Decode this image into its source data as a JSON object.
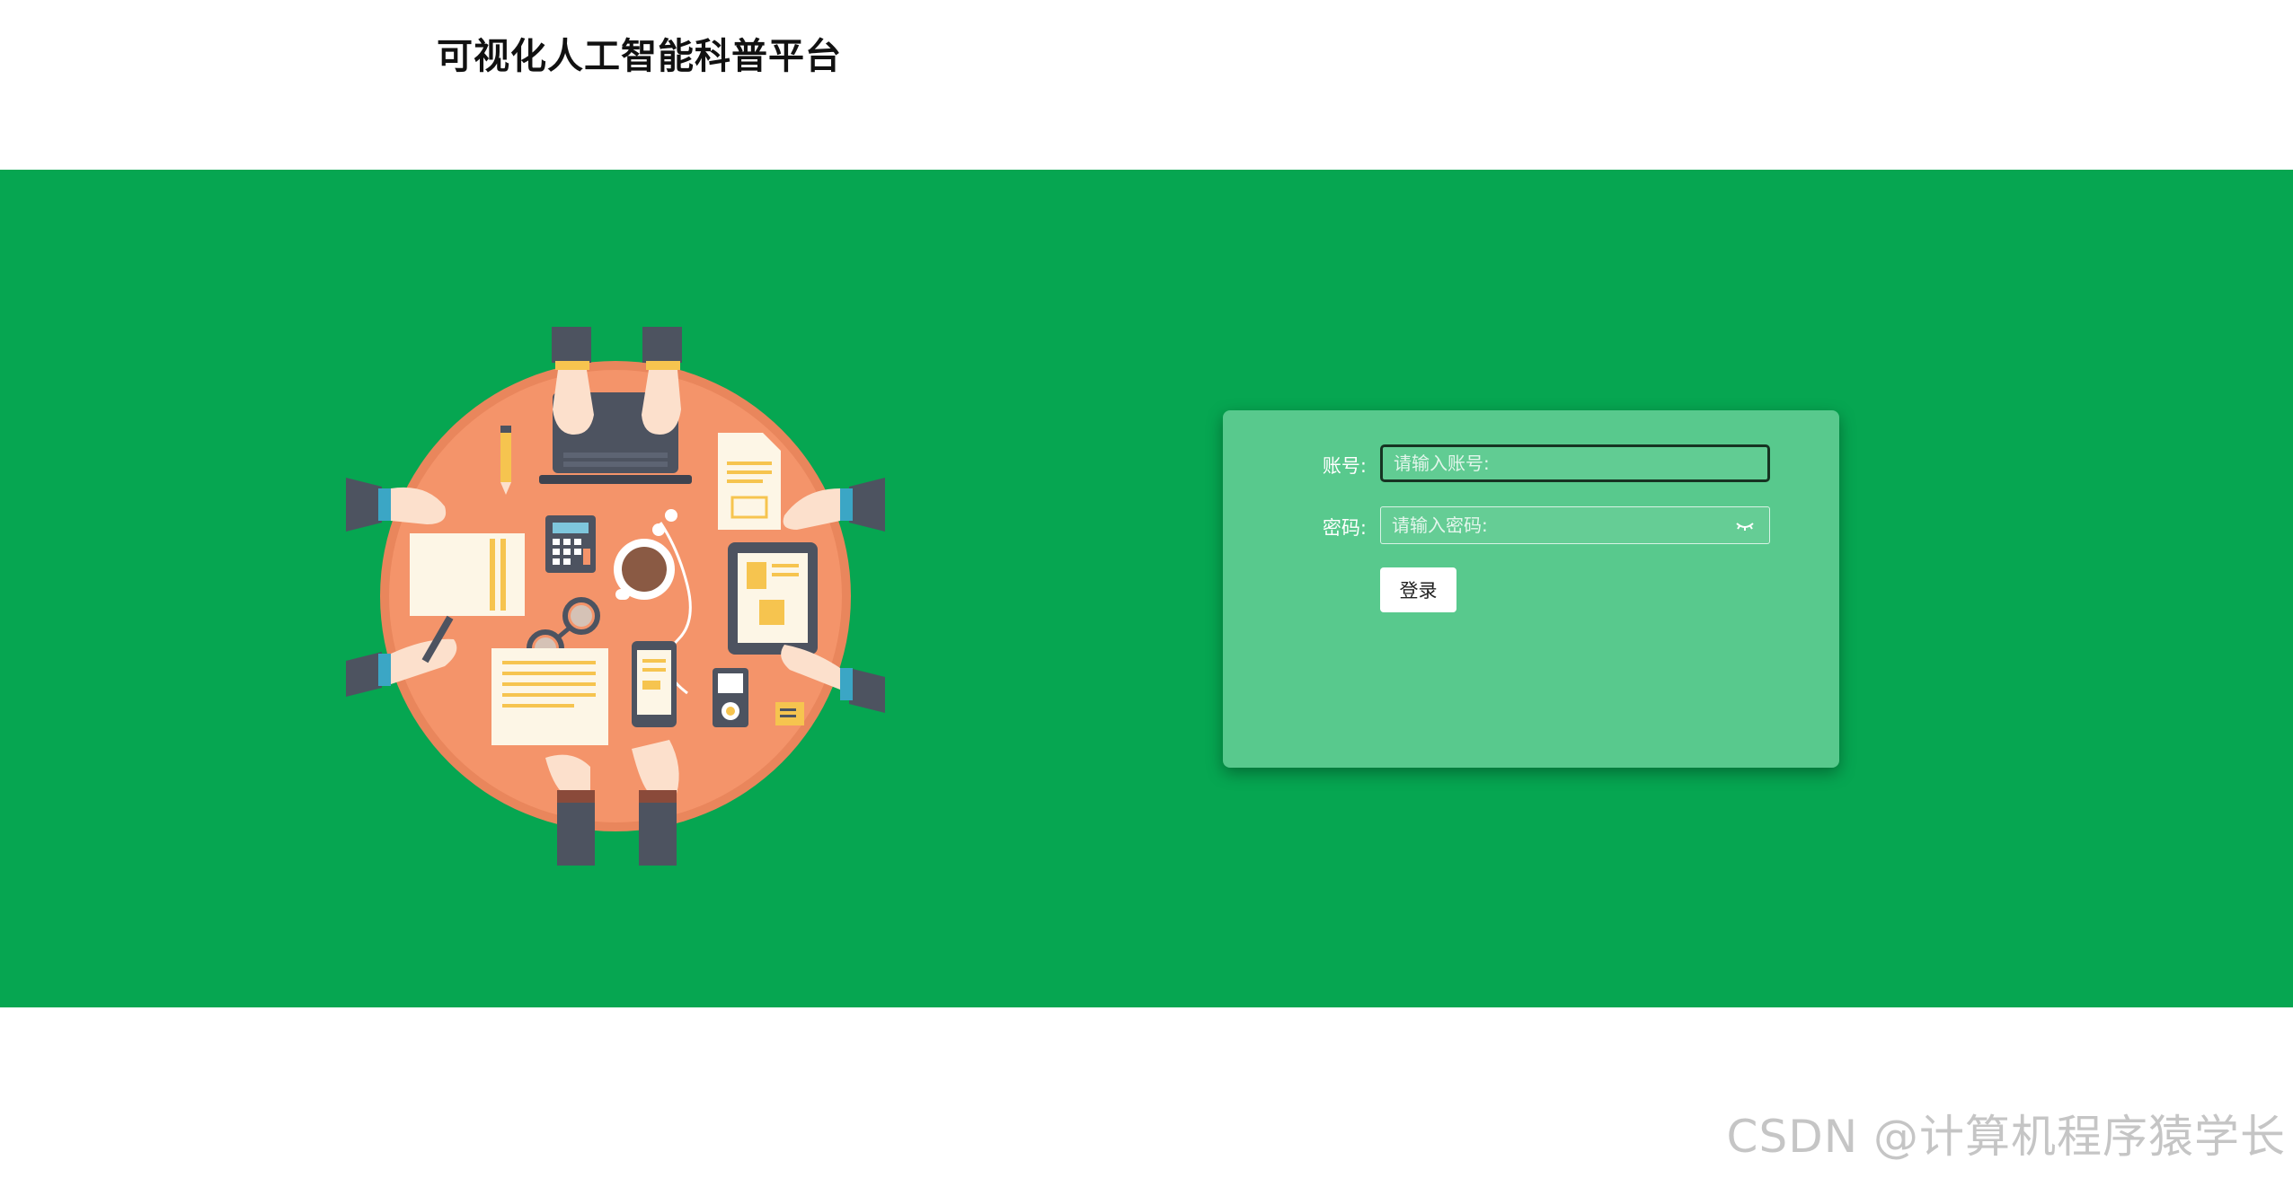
{
  "header": {
    "site_title": "可视化人工智能科普平台"
  },
  "login": {
    "account_label": "账号:",
    "account_placeholder": "请输入账号:",
    "account_value": "",
    "password_label": "密码:",
    "password_placeholder": "请输入密码:",
    "password_value": "",
    "submit_label": "登录"
  },
  "hero": {
    "background_color": "#06a651",
    "card_color": "#58c98d",
    "illustration_icon": "meeting-table-illustration",
    "table_color": "#f4946a"
  },
  "icons": {
    "password_toggle": "eye-closed-icon"
  },
  "watermark": {
    "text": "CSDN @计算机程序猿学长"
  }
}
